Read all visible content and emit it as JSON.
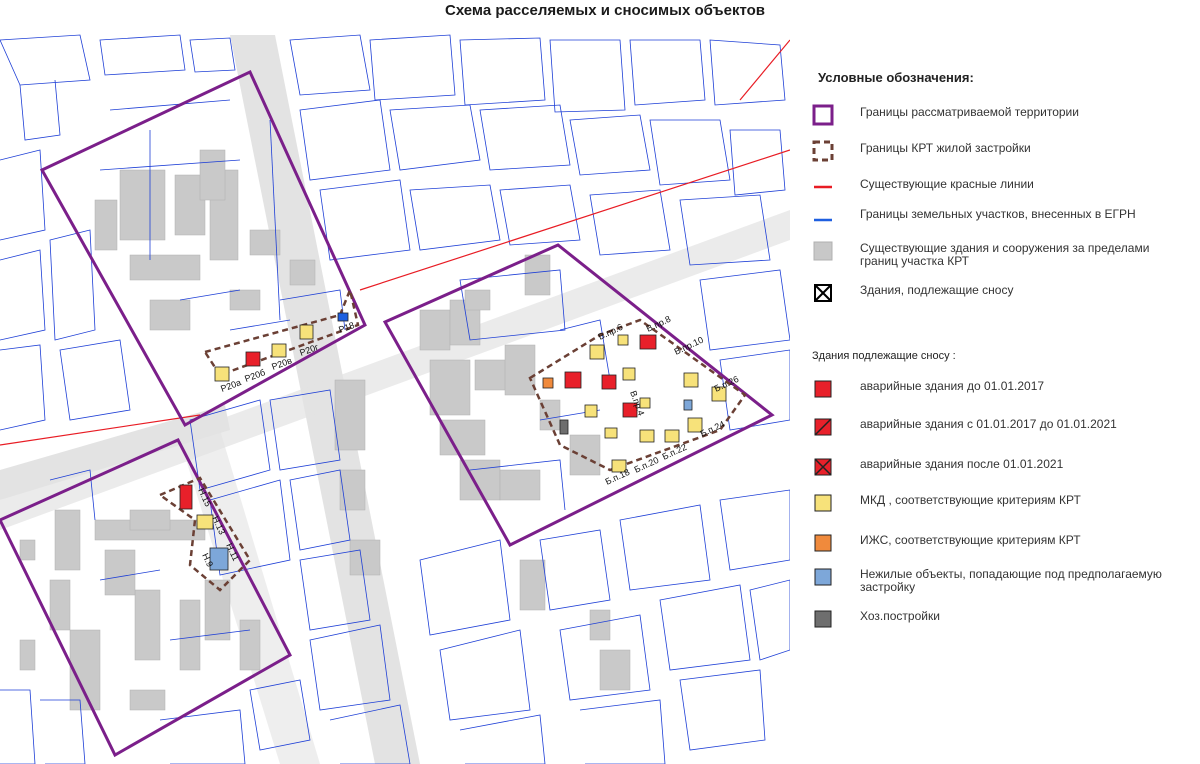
{
  "title": "Схема расселяемых и сносимых объектов",
  "map": {
    "labels_north": [
      "Р20а",
      "Р20б",
      "Р20в",
      "Р20г",
      "Р18"
    ],
    "labels_east": [
      "В.пр.8",
      "В.пр.10",
      "Б.п.26",
      "Б.п.24",
      "Б.п.18",
      "Б.п.20",
      "Б.п.22",
      "В.пр.4",
      "В.пр.6"
    ],
    "labels_southwest": [
      "Н.15",
      "Н.13",
      "Н.11",
      "Н.9"
    ]
  },
  "legend": {
    "heading": "Условные обозначения:",
    "items": [
      {
        "text": "Границы рассматриваемой территории",
        "icon": "purple-square-outline",
        "color": "#7b1f8a"
      },
      {
        "text": "Границы КРТ жилой застройки",
        "icon": "brown-dashed-square",
        "color": "#6b4035"
      },
      {
        "text": "Существующие красные линии",
        "icon": "red-line",
        "color": "#e81c24"
      },
      {
        "text": "Границы земельных участков, внесенных в ЕГРН",
        "icon": "blue-line",
        "color": "#1e5fe0"
      },
      {
        "text": "Существующие здания и сооружения за пределами границ участка КРТ",
        "icon": "grey-square",
        "color": "#c8c8c8"
      },
      {
        "text": "Здания, подлежащие сносу",
        "icon": "crossed-square",
        "color": "#000000"
      }
    ],
    "subheading": "Здания подлежащие сносу :",
    "demolition_items": [
      {
        "text": "аварийные здания до 01.01.2017",
        "icon": "red-square",
        "color": "#e8202a"
      },
      {
        "text": "аварийные здания с  01.01.2017 до 01.01.2021",
        "icon": "red-diagonal-square",
        "color": "#e8202a"
      },
      {
        "text": "аварийные здания после  01.01.2021",
        "icon": "red-crossed-square",
        "color": "#e8202a"
      },
      {
        "text": "МКД , соответствующие критериям КРТ",
        "icon": "yellow-square",
        "color": "#f7e27a"
      },
      {
        "text": "ИЖС, соответствующие критериям КРТ",
        "icon": "orange-square",
        "color": "#f08a3c"
      },
      {
        "text": "Нежилые объекты, попадающие под предполагаемую застройку",
        "icon": "blue-square",
        "color": "#7da7d9"
      },
      {
        "text": "Хоз.постройки",
        "icon": "dark-grey-square",
        "color": "#6e6e6e"
      }
    ]
  }
}
